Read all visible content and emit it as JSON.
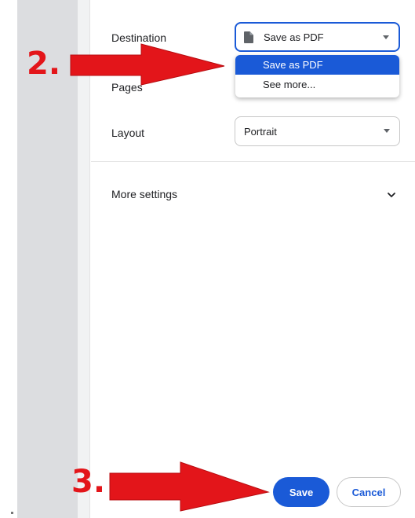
{
  "print": {
    "destination_label": "Destination",
    "destination_value": "Save as PDF",
    "pages_label": "Pages",
    "layout_label": "Layout",
    "layout_value": "Portrait",
    "dropdown_options": [
      "Save as PDF",
      "See more..."
    ],
    "more_settings_label": "More settings",
    "save_button": "Save",
    "cancel_button": "Cancel"
  },
  "annotations": {
    "step2": "2.",
    "step3": "3."
  },
  "icons": {
    "destination": "file-icon",
    "more_settings": "chevron-down-icon",
    "select_caret": "caret-down-icon"
  },
  "colors": {
    "accent": "#1a5ad7",
    "annotation_red": "#e3151a",
    "sidebar_gray": "#dcdde0"
  }
}
